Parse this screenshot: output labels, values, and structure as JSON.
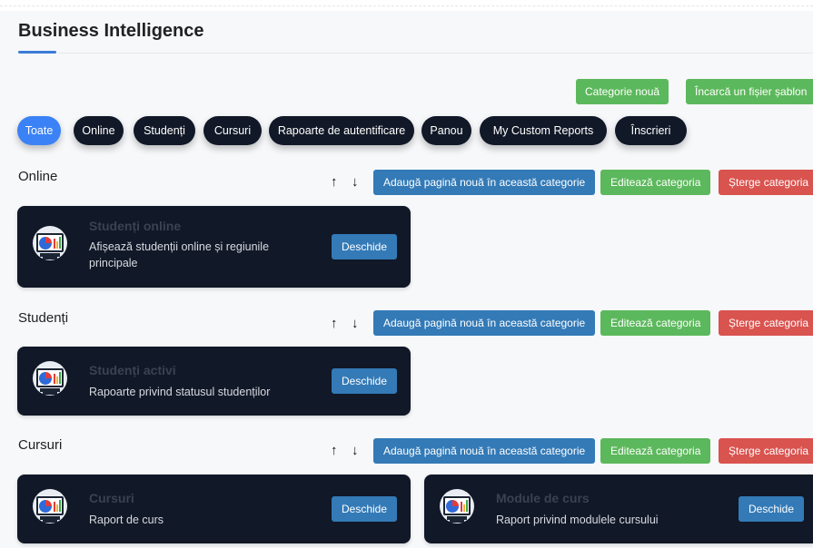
{
  "page": {
    "title": "Business Intelligence"
  },
  "toolbar": {
    "new_category": "Categorie nouă",
    "upload_template": "Încarcă un fișier șablon"
  },
  "filters": [
    "Toate",
    "Online",
    "Studenți",
    "Cursuri",
    "Rapoarte de autentificare",
    "Panou",
    "My Custom Reports",
    "Înscrieri"
  ],
  "section_actions": {
    "up": "↑",
    "down": "↓",
    "add_page": "Adaugă pagină nouă în această categorie",
    "edit": "Editează categoria",
    "delete": "Șterge categoria"
  },
  "sections": [
    {
      "title": "Online",
      "cards": [
        {
          "title": "Studenți online",
          "desc": "Afișează studenții online și regiunile principale",
          "button": "Deschide"
        }
      ]
    },
    {
      "title": "Studenți",
      "cards": [
        {
          "title": "Studenți activi",
          "desc": "Rapoarte privind statusul studenților",
          "button": "Deschide"
        }
      ]
    },
    {
      "title": "Cursuri",
      "cards": [
        {
          "title": "Cursuri",
          "desc": "Raport de curs",
          "button": "Deschide"
        },
        {
          "title": "Module de curs",
          "desc": "Raport privind modulele cursului",
          "button": "Deschide"
        }
      ]
    }
  ],
  "colors": {
    "accent": "#3b82f6",
    "green": "#5cb85c",
    "blue": "#337ab7",
    "red": "#d9534f",
    "card": "#111827"
  },
  "icons": {
    "card_icon": "report-monitor-icon"
  }
}
